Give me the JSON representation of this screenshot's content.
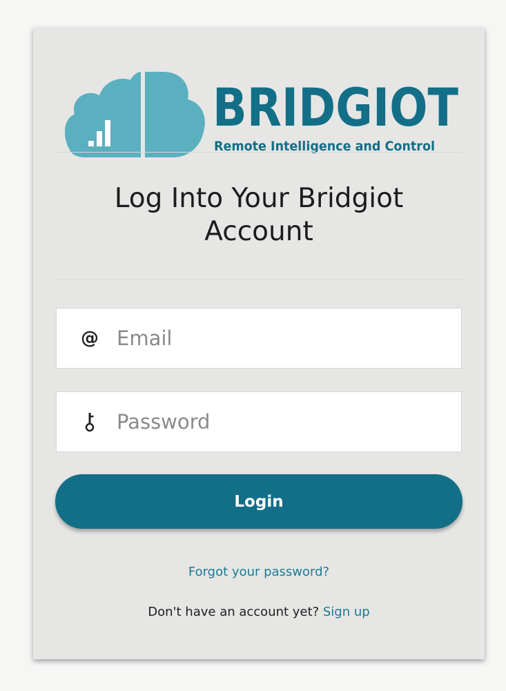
{
  "logo": {
    "wordmark": "BRIDGIOT",
    "tagline": "Remote Intelligence and Control",
    "icon": "cloud-signal-logo",
    "colors": {
      "dark": "#126f87",
      "light": "#5ab0bf"
    }
  },
  "heading": {
    "line1": "Log Into Your Bridgiot",
    "line2": "Account"
  },
  "email_field": {
    "icon": "at-icon",
    "placeholder": "Email",
    "value": ""
  },
  "password_field": {
    "icon": "key-icon",
    "placeholder": "Password",
    "value": ""
  },
  "login_button": {
    "label": "Login",
    "color": "#126f87"
  },
  "forgot_link": "Forgot your password?",
  "signup": {
    "prompt": "Don't have an account yet?",
    "link": "Sign up"
  }
}
